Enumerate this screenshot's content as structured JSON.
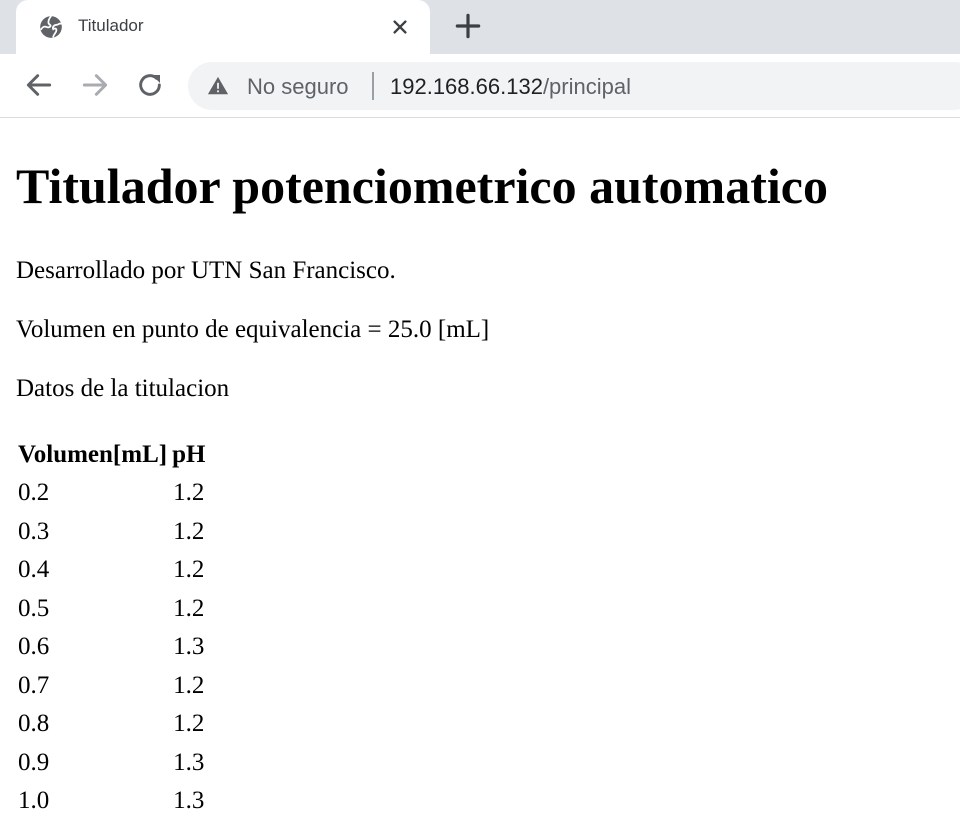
{
  "browser": {
    "tab": {
      "title": "Titulador",
      "favicon_icon": "globe-icon",
      "close_icon": "close-icon"
    },
    "new_tab_icon": "plus-icon",
    "toolbar": {
      "back_icon": "arrow-left-icon",
      "forward_icon": "arrow-right-icon",
      "reload_icon": "reload-icon"
    },
    "omnibox": {
      "security_icon": "warning-triangle-icon",
      "security_label": "No seguro",
      "url_host": "192.168.66.132",
      "url_path": "/principal"
    }
  },
  "page": {
    "title": "Titulador potenciometrico automatico",
    "developer_text": "Desarrollado por UTN San Francisco.",
    "equivalence_text": "Volumen en punto de equivalencia = 25.0 [mL]",
    "data_heading": "Datos de la titulacion",
    "table": {
      "headers": [
        "Volumen[mL]",
        "pH"
      ],
      "rows": [
        [
          "0.2",
          "1.2"
        ],
        [
          "0.3",
          "1.2"
        ],
        [
          "0.4",
          "1.2"
        ],
        [
          "0.5",
          "1.2"
        ],
        [
          "0.6",
          "1.3"
        ],
        [
          "0.7",
          "1.2"
        ],
        [
          "0.8",
          "1.2"
        ],
        [
          "0.9",
          "1.3"
        ],
        [
          "1.0",
          "1.3"
        ]
      ]
    }
  },
  "colors": {
    "tabstrip_bg": "#dee1e6",
    "omnibox_bg": "#f1f3f4",
    "icon_gray": "#5f6368",
    "disabled_gray": "#a8abaf"
  }
}
